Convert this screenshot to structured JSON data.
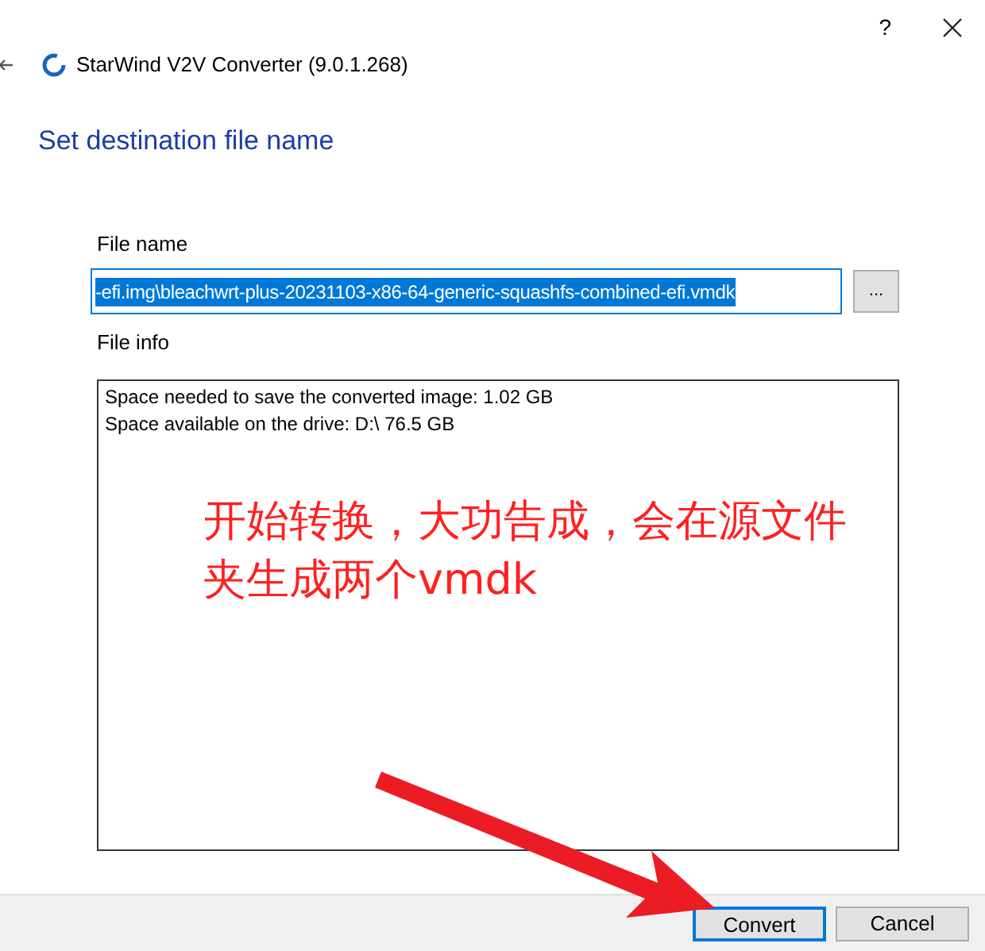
{
  "window": {
    "help": "?",
    "title": "StarWind V2V Converter (9.0.1.268)"
  },
  "heading": "Set destination file name",
  "file_name": {
    "label": "File name",
    "value": "-efi.img\\bleachwrt-plus-20231103-x86-64-generic-squashfs-combined-efi.vmdk",
    "selected": true,
    "browse": "..."
  },
  "file_info": {
    "label": "File info",
    "lines": [
      "Space needed to save the converted image: 1.02 GB",
      "Space available on the drive: D:\\ 76.5 GB"
    ]
  },
  "annotation": {
    "lines": [
      "开始转换，大功告成，会在源文件",
      "夹生成两个vmdk"
    ]
  },
  "buttons": [
    {
      "label": "Convert",
      "focused": true
    },
    {
      "label": "Cancel",
      "focused": false
    }
  ]
}
